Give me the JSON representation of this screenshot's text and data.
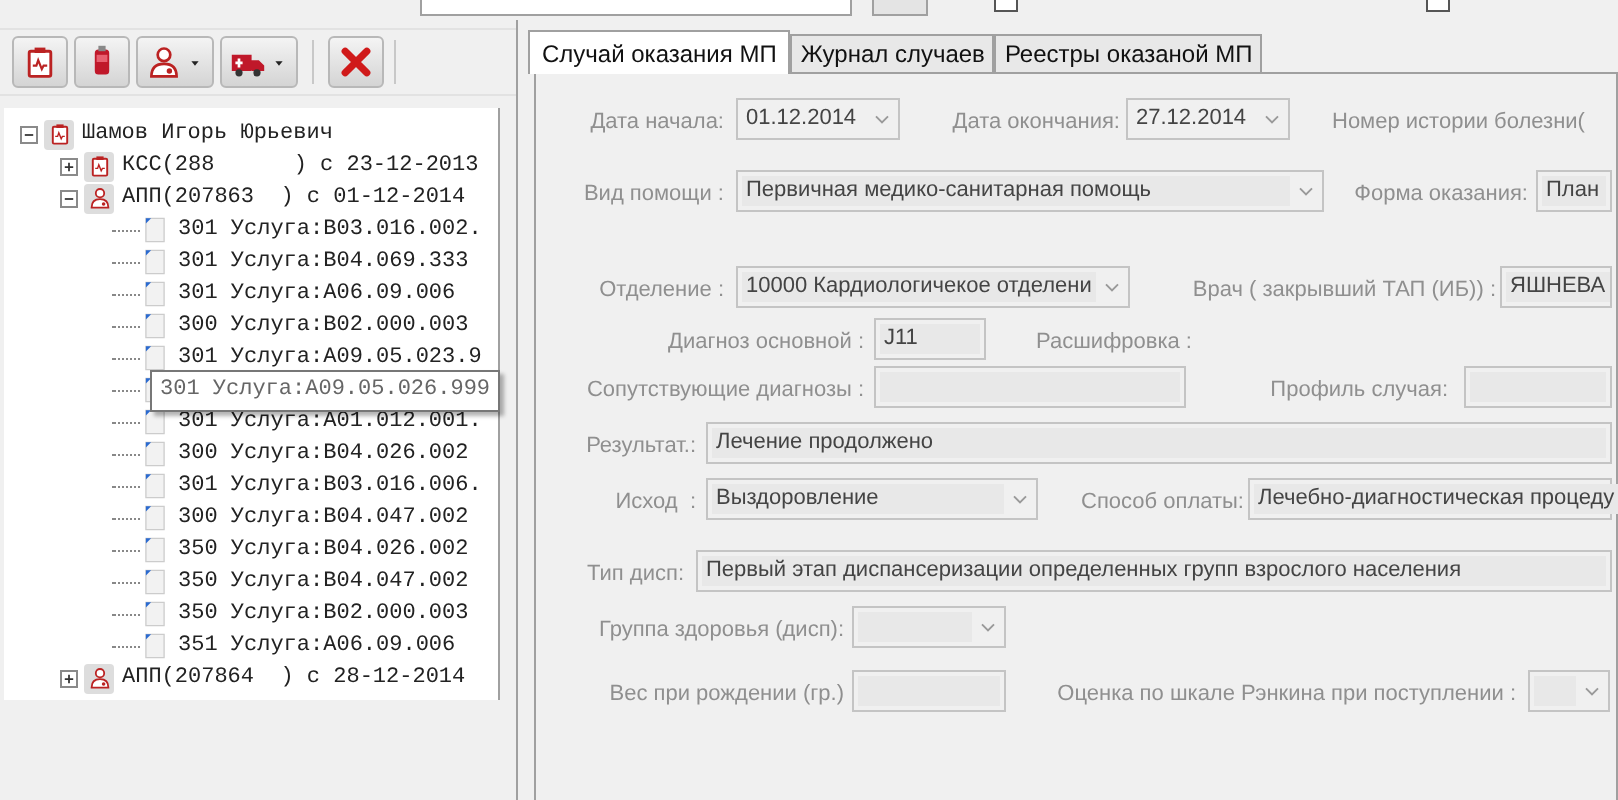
{
  "top_strip": {
    "checkboxes": [
      {
        "checked": false
      },
      {
        "checked": false
      }
    ]
  },
  "toolbar": [
    {
      "kind": "record",
      "dropdown": false
    },
    {
      "kind": "bag",
      "dropdown": false
    },
    {
      "kind": "doctor",
      "dropdown": true
    },
    {
      "kind": "ambulance",
      "dropdown": true
    },
    {
      "kind": "delete",
      "dropdown": false
    }
  ],
  "tree": [
    {
      "kind": "record",
      "label": "Шамов Игорь Юрьевич",
      "expanded": true,
      "children": [
        {
          "kind": "record",
          "label": "КСС(288      ) с 23-12-2013",
          "expanded": false
        },
        {
          "kind": "visit",
          "label": "АПП(207863  ) с 01-12-2014",
          "expanded": true,
          "children": [
            {
              "kind": "service",
              "label": "301 Услуга:B03.016.002."
            },
            {
              "kind": "service",
              "label": "301 Услуга:B04.069.333"
            },
            {
              "kind": "service",
              "label": "301 Услуга:A06.09.006"
            },
            {
              "kind": "service",
              "label": "300 Услуга:B02.000.003"
            },
            {
              "kind": "service",
              "label": "301 Услуга:A09.05.023.9"
            },
            {
              "kind": "service"
            },
            {
              "kind": "service",
              "label": "301 Услуга:A01.012.001."
            },
            {
              "kind": "service",
              "label": "300 Услуга:B04.026.002"
            },
            {
              "kind": "service",
              "label": "301 Услуга:B03.016.006."
            },
            {
              "kind": "service",
              "label": "300 Услуга:B04.047.002"
            },
            {
              "kind": "service",
              "label": "350 Услуга:B04.026.002"
            },
            {
              "kind": "service",
              "label": "350 Услуга:B04.047.002"
            },
            {
              "kind": "service",
              "label": "350 Услуга:B02.000.003"
            },
            {
              "kind": "service",
              "label": "351 Услуга:A06.09.006"
            }
          ]
        },
        {
          "kind": "visit",
          "label": "АПП(207864  ) с 28-12-2014",
          "expanded": false
        }
      ]
    }
  ],
  "tooltip": {
    "text": "301 Услуга:A09.05.026.999"
  },
  "tabs": [
    {
      "label": "Случай оказания МП",
      "selected": true
    },
    {
      "label": "Журнал случаев",
      "selected": false
    },
    {
      "label": "Реестры оказаной МП",
      "selected": false
    }
  ],
  "form": [
    [
      {
        "kind": "label",
        "text": "Дата начала:"
      },
      {
        "kind": "date",
        "value": "01.12.2014"
      },
      {
        "kind": "label",
        "text": "Дата окончания:"
      },
      {
        "kind": "date",
        "value": "27.12.2014"
      },
      {
        "kind": "label",
        "text": "Номер истории болезни("
      }
    ],
    [
      {
        "kind": "label",
        "text": "Вид помощи :"
      },
      {
        "kind": "combo",
        "value": "Первичная медико-санитарная помощь"
      },
      {
        "kind": "label",
        "text": "Форма оказания:"
      },
      {
        "kind": "text",
        "value": "План"
      }
    ],
    [
      {
        "kind": "label",
        "text": "Отделение :"
      },
      {
        "kind": "combo",
        "value": "10000 Кардиологичекое отделени"
      },
      {
        "kind": "label",
        "text": "Врач ( закрывший ТАП (ИБ)) :"
      },
      {
        "kind": "text",
        "value": "ЯШНЕВА"
      }
    ],
    [
      {
        "kind": "label",
        "text": "Диагноз основной :"
      },
      {
        "kind": "text",
        "value": "J11"
      },
      {
        "kind": "label",
        "text": "Расшифровка :"
      }
    ],
    [
      {
        "kind": "label",
        "text": "Сопутствующие диагнозы :"
      },
      {
        "kind": "text"
      },
      {
        "kind": "label",
        "text": "Профиль случая:"
      },
      {
        "kind": "text"
      }
    ],
    [
      {
        "kind": "label",
        "text": "Результат.:"
      },
      {
        "kind": "text",
        "value": "Лечение продолжено"
      }
    ],
    [
      {
        "kind": "label",
        "text": "Исход  :"
      },
      {
        "kind": "combo",
        "value": "Выздоровление"
      },
      {
        "kind": "label",
        "text": "Способ оплаты:"
      },
      {
        "kind": "text",
        "value": "Лечебно-диагностическая процеду"
      }
    ],
    [
      {
        "kind": "label",
        "text": "Тип дисп:"
      },
      {
        "kind": "text",
        "value": "Первый этап диспансеризации определенных групп взрослого населения"
      }
    ],
    [
      {
        "kind": "label",
        "text": "Группа здоровья (дисп):"
      },
      {
        "kind": "combo"
      }
    ],
    [
      {
        "kind": "label",
        "text": "Вес при рождении (гр.)"
      },
      {
        "kind": "text"
      },
      {
        "kind": "label",
        "text": "Оценка по шкале Рэнкина при поступлении :"
      },
      {
        "kind": "combo"
      }
    ]
  ]
}
